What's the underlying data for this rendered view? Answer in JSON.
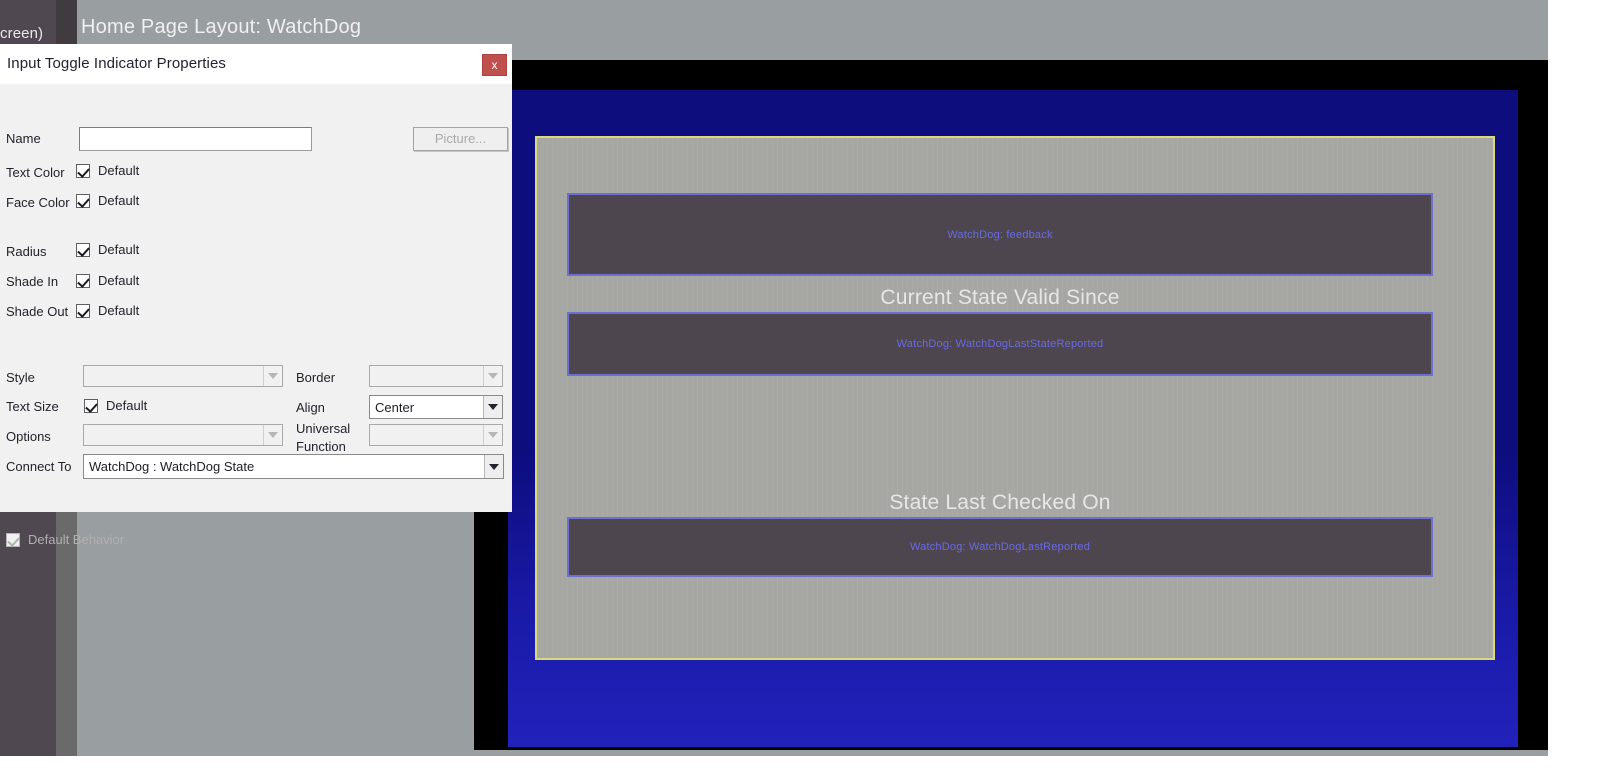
{
  "app": {
    "rail_label": "creen)",
    "editor_title": "Home Page Layout: WatchDog"
  },
  "canvas": {
    "elements": [
      {
        "kind": "indicator",
        "text": "WatchDog: feedback"
      },
      {
        "kind": "label",
        "text": "Current State Valid Since"
      },
      {
        "kind": "indicator",
        "text": "WatchDog: WatchDogLastStateReported"
      },
      {
        "kind": "label",
        "text": "State Last Checked On"
      },
      {
        "kind": "indicator",
        "text": "WatchDog: WatchDogLastReported"
      }
    ],
    "colors": {
      "frame_blue": "#0d0d7e",
      "frame_black": "#000000",
      "page_border_yellow": "#d9d97a",
      "page_face": "#a6a6a3",
      "indicator_face": "#4d464e",
      "indicator_border": "#6f6fd0",
      "indicator_text": "#6a6ae2",
      "label_text": "#e7e7e7"
    }
  },
  "dialog": {
    "title": "Input Toggle Indicator Properties",
    "close_label": "x",
    "fields": {
      "name_label": "Name",
      "name_value": "",
      "name_placeholder": "",
      "picture_button": "Picture...",
      "text_color_label": "Text Color",
      "text_color_default": "Default",
      "text_color_checked": true,
      "face_color_label": "Face Color",
      "face_color_default": "Default",
      "face_color_checked": true,
      "radius_label": "Radius",
      "radius_default": "Default",
      "radius_checked": true,
      "shade_in_label": "Shade In",
      "shade_in_default": "Default",
      "shade_in_checked": true,
      "shade_out_label": "Shade Out",
      "shade_out_default": "Default",
      "shade_out_checked": true,
      "style_label": "Style",
      "style_value": "",
      "border_label": "Border",
      "border_value": "",
      "text_size_label": "Text Size",
      "text_size_default": "Default",
      "text_size_checked": true,
      "align_label": "Align",
      "align_value": "Center",
      "options_label": "Options",
      "options_value": "",
      "universal_function_label_line1": "Universal",
      "universal_function_label_line2": "Function",
      "universal_function_value": "",
      "connect_to_label": "Connect To",
      "connect_to_value": "WatchDog : WatchDog State",
      "default_behavior_label": "Default Behavior",
      "default_behavior_checked": true
    },
    "colors": {
      "close_button": "#c0504d",
      "title_bar": "#ffffff",
      "body": "#f1f1f1"
    }
  }
}
